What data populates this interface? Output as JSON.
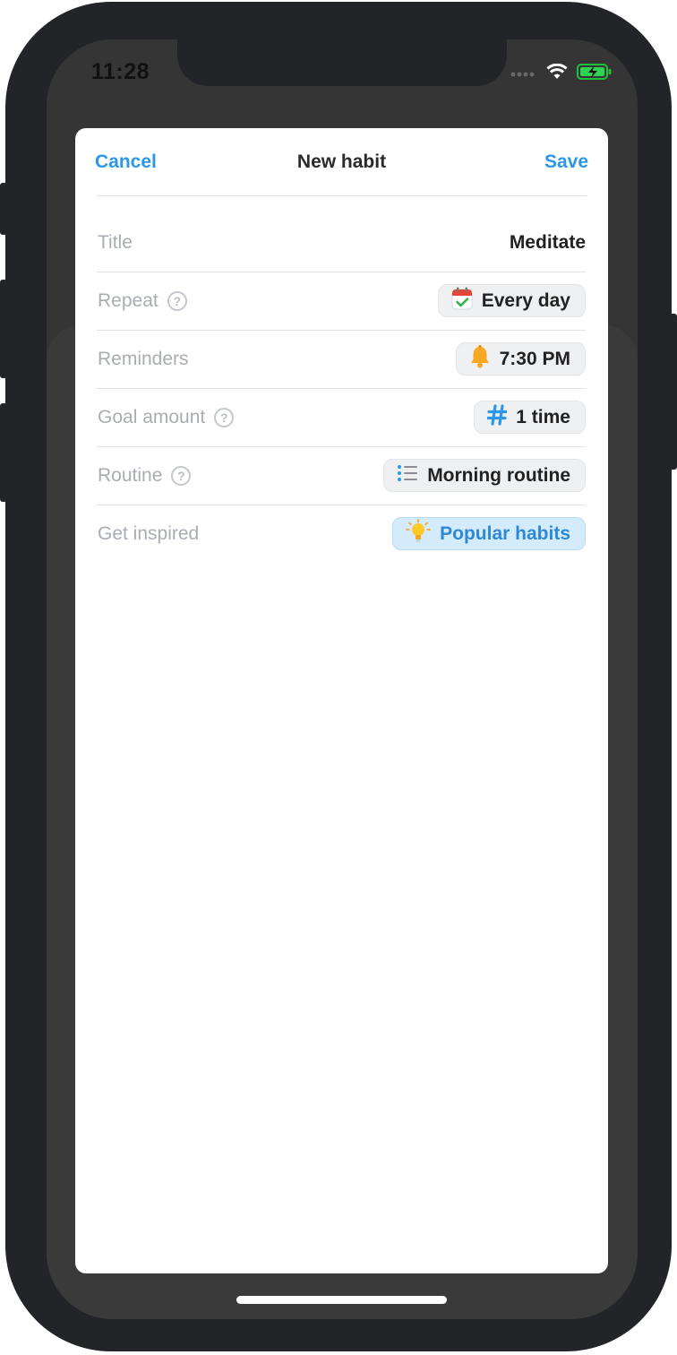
{
  "status_bar": {
    "time": "11:28"
  },
  "nav": {
    "cancel": "Cancel",
    "title": "New habit",
    "save": "Save"
  },
  "form": {
    "title": {
      "label": "Title",
      "value": "Meditate"
    },
    "repeat": {
      "label": "Repeat",
      "value": "Every day",
      "icon": "calendar-check-icon"
    },
    "reminders": {
      "label": "Reminders",
      "value": "7:30 PM",
      "icon": "bell-icon"
    },
    "goal": {
      "label": "Goal amount",
      "value": "1 time",
      "icon": "hash-icon"
    },
    "routine": {
      "label": "Routine",
      "value": "Morning routine",
      "icon": "list-icon"
    },
    "inspired": {
      "label": "Get inspired",
      "value": "Popular habits",
      "icon": "lightbulb-icon"
    }
  },
  "colors": {
    "accent": "#2d97ea",
    "label": "#a9adb3",
    "pill_bg": "#eff0f2",
    "pill_blue_bg": "#d4ebfb"
  }
}
